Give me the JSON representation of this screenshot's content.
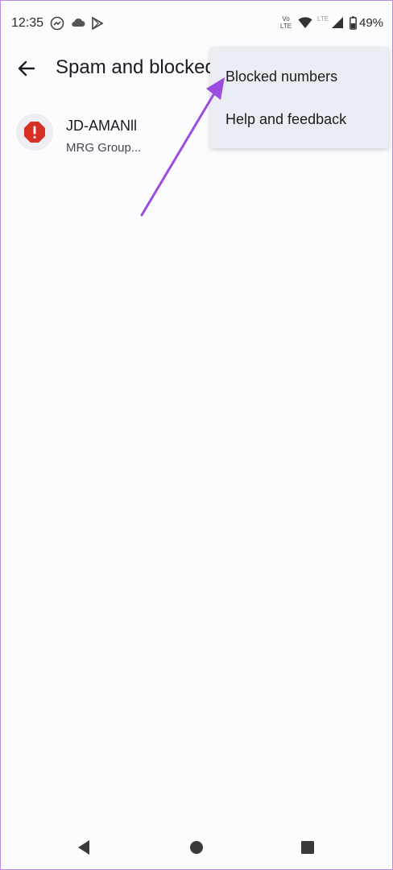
{
  "status_bar": {
    "time": "12:35",
    "volte_top": "Vo",
    "volte_bottom": "LTE",
    "lte": "LTE",
    "battery": "49%"
  },
  "app_bar": {
    "title": "Spam and blocked"
  },
  "list": {
    "items": [
      {
        "name": "JD-AMANll",
        "subtitle": "MRG Group..."
      }
    ]
  },
  "menu": {
    "items": [
      {
        "label": "Blocked numbers"
      },
      {
        "label": "Help and feedback"
      }
    ]
  },
  "colors": {
    "accent_arrow": "#9b4de0",
    "spam_red": "#d93025",
    "menu_bg": "#eaeef4"
  }
}
